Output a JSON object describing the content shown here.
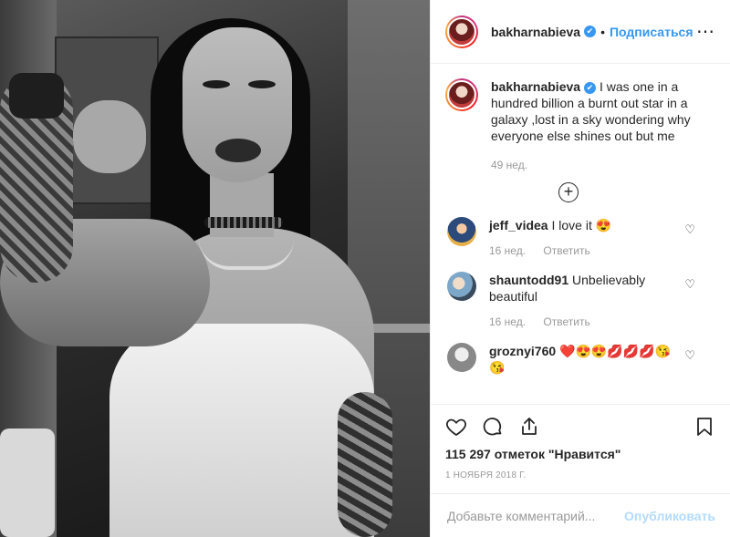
{
  "header": {
    "username": "bakharnabieva",
    "verified_mark": "✔",
    "separator": "•",
    "follow_label": "Подписаться",
    "more_glyph": "⋯"
  },
  "caption": {
    "username": "bakharnabieva",
    "verified_mark": "✔",
    "text": "I was one in a hundred billion a burnt out star in a galaxy ,lost in a sky wondering why everyone else shines out but me",
    "time": "49 нед.",
    "load_more_glyph": "+"
  },
  "comments": [
    {
      "username": "jeff_videa",
      "text": "I love it 😍",
      "time": "16 нед.",
      "reply_label": "Ответить",
      "like_glyph": "♡"
    },
    {
      "username": "shauntodd91",
      "text": "Unbelievably beautiful",
      "time": "16 нед.",
      "reply_label": "Ответить",
      "like_glyph": "♡"
    },
    {
      "username": "groznyi760",
      "text": "❤️😍😍💋💋💋😘😘",
      "time": "",
      "reply_label": "",
      "like_glyph": "♡"
    }
  ],
  "actions": {
    "likes_text": "115 297 отметок \"Нравится\"",
    "date": "1 НОЯБРЯ 2018 Г."
  },
  "add_comment": {
    "placeholder": "Добавьте комментарий...",
    "publish_label": "Опубликовать"
  },
  "colors": {
    "accent": "#3897f0",
    "publish_disabled": "#b3dbff",
    "muted": "#999999",
    "divider": "#efefef"
  }
}
